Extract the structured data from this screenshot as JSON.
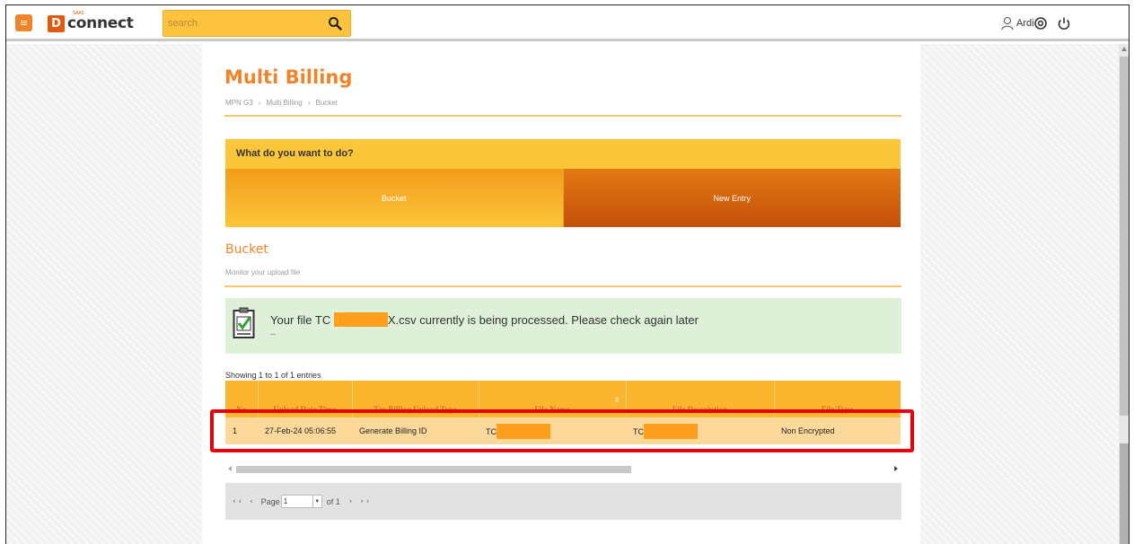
{
  "header": {
    "menu_icon": "menu-icon",
    "logo_mark": "D",
    "logo_sup": "SAAS",
    "logo_text": "connect",
    "search_placeholder": "search",
    "search_icon": "search-icon",
    "user_name": "Ardi",
    "user_icon": "user-icon",
    "icons": [
      "help-icon",
      "power-icon"
    ]
  },
  "page": {
    "title": "Multi Billing",
    "breadcrumb": [
      "MPN G3",
      "›",
      "Multi Billing",
      "›",
      "Bucket"
    ]
  },
  "actions": {
    "heading": "What do you want to do?",
    "tabs": [
      "Bucket",
      "New Entry"
    ]
  },
  "bucket": {
    "title": "Bucket",
    "subtitle": "Monitor your upload file"
  },
  "alert": {
    "prefix": "Your file TC",
    "suffix": "X.csv currently is being processed. Please check again later",
    "dash": "--",
    "icon": "clipboard-check-icon"
  },
  "table": {
    "showing": "Showing 1 to 1 of 1 entries",
    "columns": [
      "No",
      "Upload Date Time",
      "Tax Billing Upload Type",
      "File Name",
      "File Description",
      "File Type"
    ],
    "rows": [
      {
        "no": "1",
        "upload_date_time": "27-Feb-24 05:06:55",
        "type": "Generate Billing ID",
        "file_name": "TC",
        "file_description": "TC",
        "file_type": "Non Encrypted"
      }
    ]
  },
  "pager": {
    "first": "‹ ‹",
    "prev": "‹",
    "page_label": "Page",
    "page_value": "1",
    "of_label": "of 1",
    "next": "›",
    "last": "› ›"
  },
  "colors": {
    "accent": "#f0842a",
    "header_yellow": "#fcc63a",
    "alert_green": "#dff0d8",
    "highlight_red": "#e8000f"
  }
}
